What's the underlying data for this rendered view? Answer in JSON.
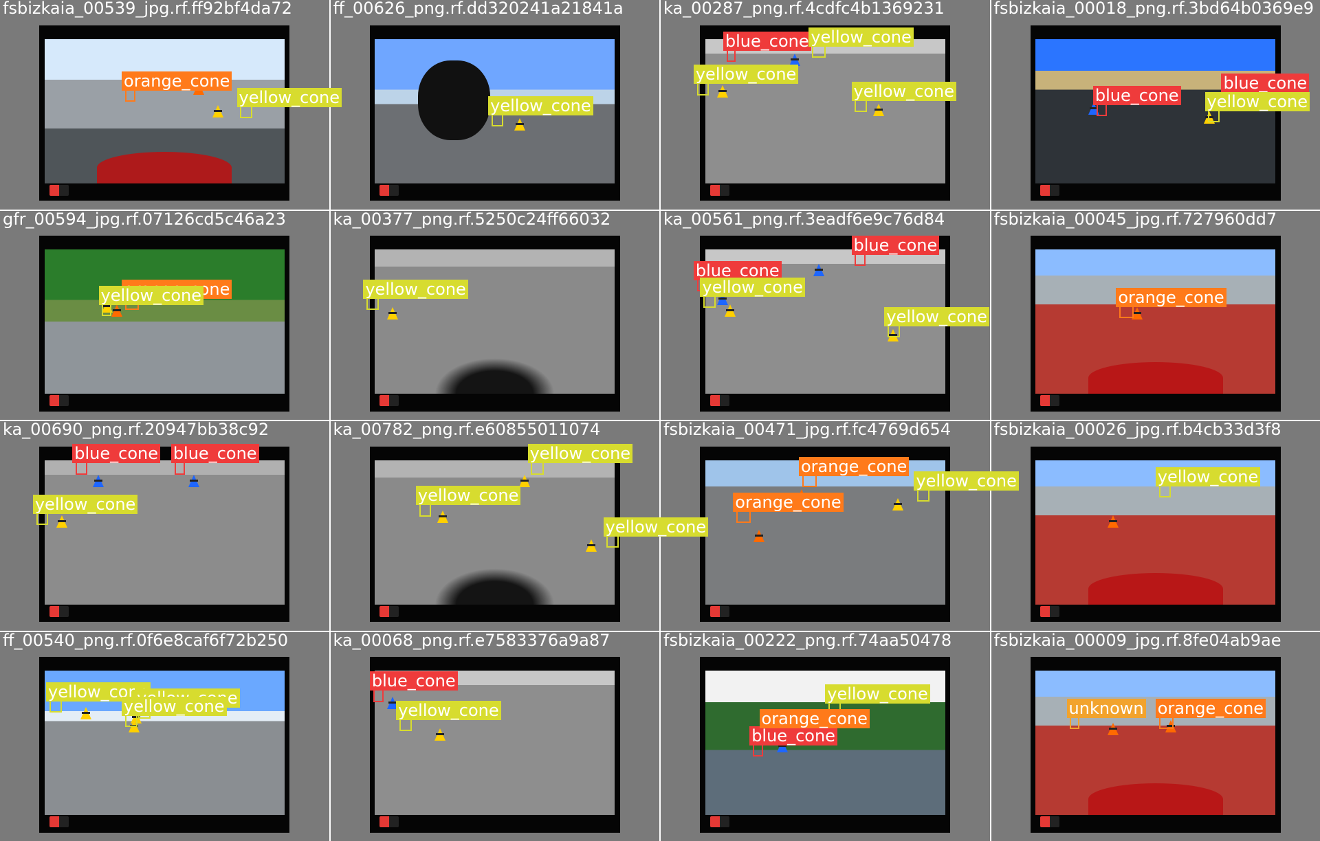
{
  "palette": {
    "yellow": "#d7dc2f",
    "orange": "#ff7a1a",
    "blue": "#ef3b3b",
    "unknown": "#f2a32d"
  },
  "cells": [
    {
      "caption": "fsbizkaia_00539_jpg.rf.ff92bf4da72",
      "scene": "road_grass",
      "car": true
    },
    {
      "caption": "ff_00626_png.rf.dd320241a21841a",
      "scene": "road_sky",
      "helmet": true
    },
    {
      "caption": "ka_00287_png.rf.4cdfc4b1369231",
      "scene": "asphalt"
    },
    {
      "caption": "fsbizkaia_00018_png.rf.3bd64b0369e9",
      "scene": "town"
    },
    {
      "caption": "gfr_00594_jpg.rf.07126cd5c46a23",
      "scene": "green"
    },
    {
      "caption": "ka_00377_png.rf.5250c24ff66032",
      "scene": "asphalt_shadow",
      "shadow": true
    },
    {
      "caption": "ka_00561_png.rf.3eadf6e9c76d84",
      "scene": "asphalt"
    },
    {
      "caption": "fsbizkaia_00045_jpg.rf.727960dd7",
      "scene": "pit",
      "car": true
    },
    {
      "caption": "ka_00690_png.rf.20947bb38c92",
      "scene": "asphalt_light"
    },
    {
      "caption": "ka_00782_png.rf.e60855011074",
      "scene": "asphalt_shadow",
      "shadow": true
    },
    {
      "caption": "fsbizkaia_00471_jpg.rf.fc4769d654",
      "scene": "asphalt_track"
    },
    {
      "caption": "fsbizkaia_00026_jpg.rf.b4cb33d3f8",
      "scene": "pit",
      "car": true
    },
    {
      "caption": "ff_00540_png.rf.0f6e8caf6f72b250",
      "scene": "road_sky_alt"
    },
    {
      "caption": "ka_00068_png.rf.e7583376a9a87",
      "scene": "asphalt"
    },
    {
      "caption": "fsbizkaia_00222_png.rf.74aa50478",
      "scene": "rain"
    },
    {
      "caption": "fsbizkaia_00009_jpg.rf.8fe04ab9ae",
      "scene": "pit",
      "car": true
    }
  ],
  "labels": [
    {
      "cell": 0,
      "text": "orange_cone",
      "cls": "orange"
    },
    {
      "cell": 0,
      "text": "yellow_cone",
      "cls": "yellow"
    },
    {
      "cell": 1,
      "text": "yellow_cone",
      "cls": "yellow"
    },
    {
      "cell": 2,
      "text": "blue_cone",
      "cls": "blue"
    },
    {
      "cell": 2,
      "text": "yellow_cone",
      "cls": "yellow"
    },
    {
      "cell": 2,
      "text": "yellow_cone",
      "cls": "yellow"
    },
    {
      "cell": 2,
      "text": "yellow_cone",
      "cls": "yellow"
    },
    {
      "cell": 3,
      "text": "blue_cone",
      "cls": "blue"
    },
    {
      "cell": 3,
      "text": "blue_cone",
      "cls": "blue"
    },
    {
      "cell": 3,
      "text": "yellow_cone",
      "cls": "yellow"
    },
    {
      "cell": 4,
      "text": "orange_cone",
      "cls": "orange"
    },
    {
      "cell": 4,
      "text": "yellow_cone",
      "cls": "yellow"
    },
    {
      "cell": 5,
      "text": "yellow_cone",
      "cls": "yellow"
    },
    {
      "cell": 6,
      "text": "blue_cone",
      "cls": "blue"
    },
    {
      "cell": 6,
      "text": "blue_cone",
      "cls": "blue"
    },
    {
      "cell": 6,
      "text": "yellow_cone",
      "cls": "yellow"
    },
    {
      "cell": 6,
      "text": "yellow_cone",
      "cls": "yellow"
    },
    {
      "cell": 7,
      "text": "orange_cone",
      "cls": "orange"
    },
    {
      "cell": 8,
      "text": "blue_cone",
      "cls": "blue"
    },
    {
      "cell": 8,
      "text": "blue_cone",
      "cls": "blue"
    },
    {
      "cell": 8,
      "text": "yellow_cone",
      "cls": "yellow"
    },
    {
      "cell": 9,
      "text": "yellow_cone",
      "cls": "yellow"
    },
    {
      "cell": 9,
      "text": "yellow_cone",
      "cls": "yellow"
    },
    {
      "cell": 9,
      "text": "yellow_cone",
      "cls": "yellow"
    },
    {
      "cell": 10,
      "text": "orange_cone",
      "cls": "orange"
    },
    {
      "cell": 10,
      "text": "orange_cone",
      "cls": "orange"
    },
    {
      "cell": 10,
      "text": "yellow_cone",
      "cls": "yellow"
    },
    {
      "cell": 11,
      "text": "yellow_cone",
      "cls": "yellow"
    },
    {
      "cell": 12,
      "text": "yellow_cone",
      "cls": "yellow"
    },
    {
      "cell": 12,
      "text": "yellow_cone",
      "cls": "yellow"
    },
    {
      "cell": 12,
      "text": "yellow_cone",
      "cls": "yellow"
    },
    {
      "cell": 13,
      "text": "blue_cone",
      "cls": "blue"
    },
    {
      "cell": 13,
      "text": "yellow_cone",
      "cls": "yellow"
    },
    {
      "cell": 14,
      "text": "blue_cone",
      "cls": "blue"
    },
    {
      "cell": 14,
      "text": "yellow_cone",
      "cls": "yellow"
    },
    {
      "cell": 14,
      "text": "orange_cone",
      "cls": "orange"
    },
    {
      "cell": 15,
      "text": "unknown",
      "cls": "unknown"
    },
    {
      "cell": 15,
      "text": "orange_cone",
      "cls": "orange"
    }
  ]
}
